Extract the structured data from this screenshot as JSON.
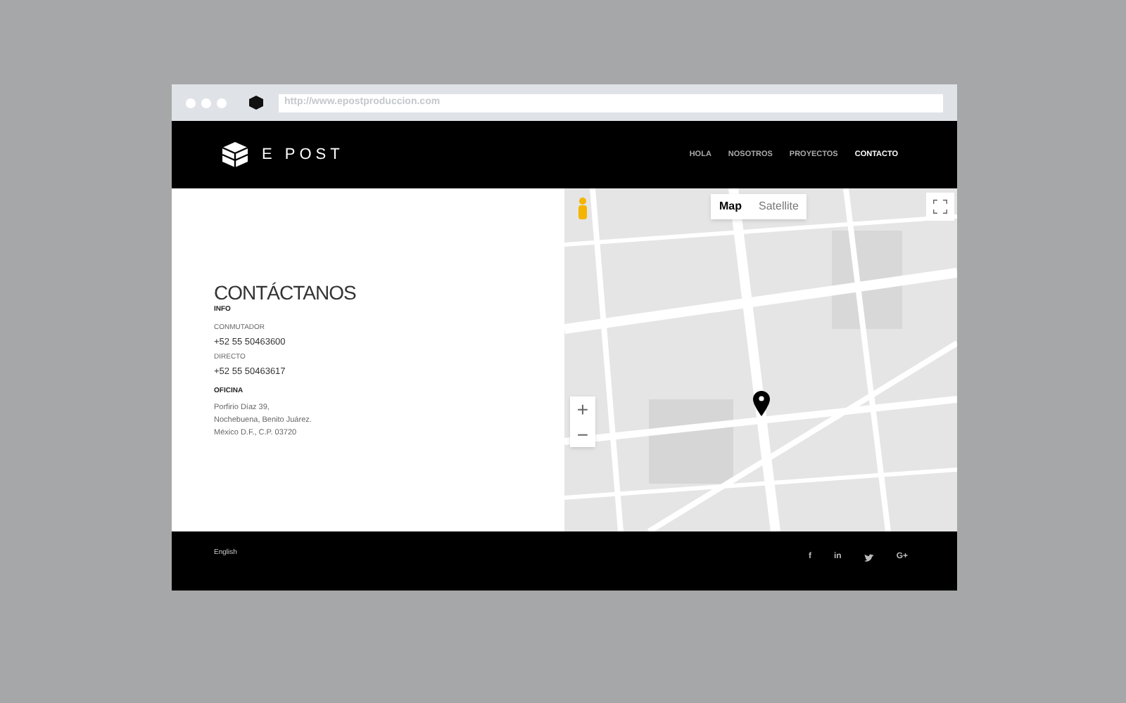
{
  "browser": {
    "url": "http://www.epostproduccion.com"
  },
  "header": {
    "logo": "E POST",
    "nav": [
      {
        "label": "HOLA",
        "selected": false
      },
      {
        "label": "NOSOTROS",
        "selected": false
      },
      {
        "label": "PROYECTOS",
        "selected": false
      },
      {
        "label": "CONTACTO",
        "selected": true
      }
    ]
  },
  "contact": {
    "title": "CONTÁCTANOS",
    "sections": [
      {
        "heading": "INFO",
        "lines": [
          {
            "kind": "label",
            "text": "CONMUTADOR"
          },
          {
            "kind": "value",
            "text": "+52 55 50463600"
          },
          {
            "kind": "label",
            "text": "DIRECTO"
          },
          {
            "kind": "value",
            "text": "+52 55 50463617"
          }
        ]
      },
      {
        "heading": "OFICINA",
        "lines": [
          {
            "kind": "address",
            "text": "Porfirio Díaz 39,"
          },
          {
            "kind": "address",
            "text": "Nochebuena, Benito Juárez."
          },
          {
            "kind": "address",
            "text": "México D.F., C.P. 03720"
          }
        ]
      }
    ]
  },
  "map": {
    "types": [
      {
        "label": "Map",
        "selected": true
      },
      {
        "label": "Satellite",
        "selected": false
      }
    ],
    "zoom_in": "+",
    "zoom_out": "−"
  },
  "footer": {
    "language": "English",
    "social": [
      {
        "kind": "text",
        "label": "f"
      },
      {
        "kind": "text",
        "label": "in"
      },
      {
        "kind": "bird"
      },
      {
        "kind": "text",
        "label": "G+"
      }
    ]
  }
}
